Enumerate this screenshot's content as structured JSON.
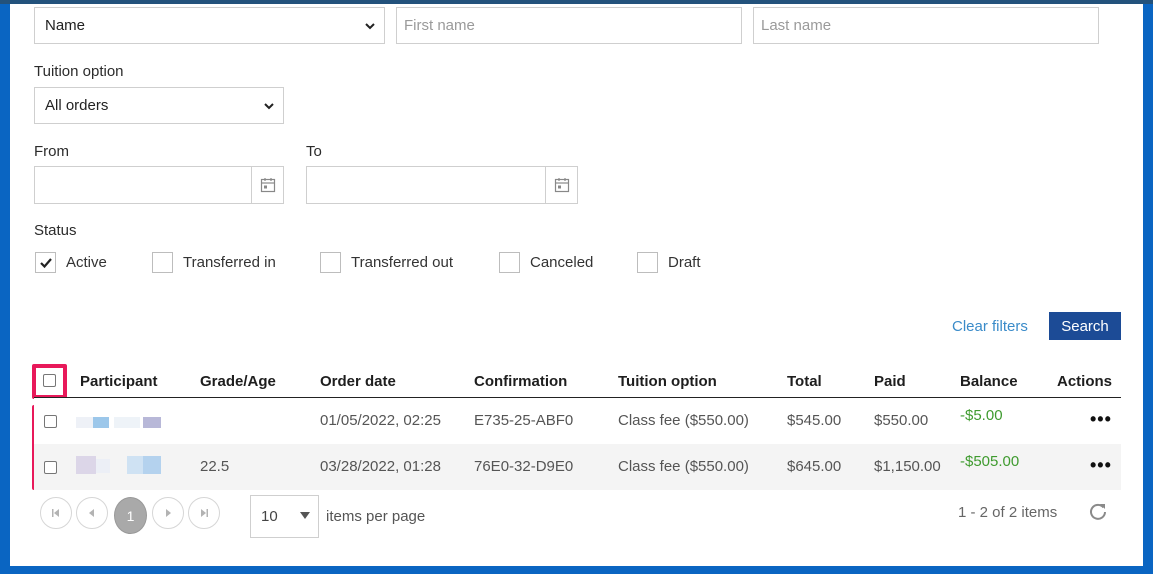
{
  "filters": {
    "search_by": "Name",
    "first_name_placeholder": "First name",
    "last_name_placeholder": "Last name",
    "tuition_label": "Tuition option",
    "tuition_value": "All orders",
    "from_label": "From",
    "to_label": "To",
    "status_label": "Status",
    "statuses": [
      {
        "label": "Active",
        "checked": true
      },
      {
        "label": "Transferred in",
        "checked": false
      },
      {
        "label": "Transferred out",
        "checked": false
      },
      {
        "label": "Canceled",
        "checked": false
      },
      {
        "label": "Draft",
        "checked": false
      }
    ],
    "clear_label": "Clear filters",
    "search_label": "Search"
  },
  "table": {
    "headers": [
      "Participant",
      "Grade/Age",
      "Order date",
      "Confirmation",
      "Tuition option",
      "Total",
      "Paid",
      "Balance",
      "Actions"
    ],
    "rows": [
      {
        "grade": "",
        "order_date": "01/05/2022, 02:25",
        "confirmation": "E735-25-ABF0",
        "tuition": "Class fee ($550.00)",
        "total": "$545.00",
        "paid": "$550.00",
        "balance": "-$5.00",
        "actions": "•••"
      },
      {
        "grade": "22.5",
        "order_date": "03/28/2022, 01:28",
        "confirmation": "76E0-32-D9E0",
        "tuition": "Class fee ($550.00)",
        "total": "$645.00",
        "paid": "$1,150.00",
        "balance": "-$505.00",
        "actions": "•••"
      }
    ]
  },
  "pagination": {
    "current_page": "1",
    "page_size": "10",
    "per_page_label": "items per page",
    "summary": "1 - 2 of 2 items"
  },
  "colors": {
    "accent": "#1c4b96",
    "link": "#3a8bc9",
    "highlight": "#e8195a",
    "balance": "#3f9b2f"
  }
}
